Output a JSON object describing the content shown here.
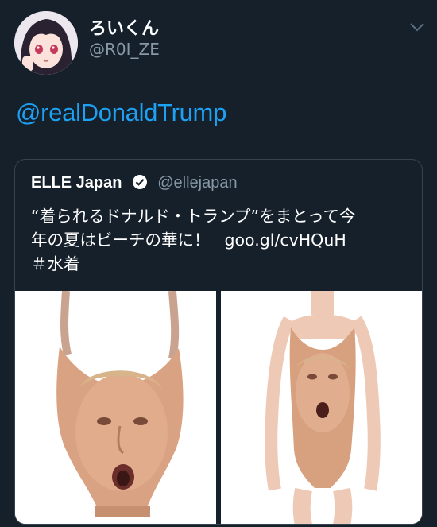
{
  "tweet": {
    "display_name": "ろいくん",
    "handle": "@R0I_ZE",
    "text": "@realDonaldTrump",
    "avatar_icon": "anime-girl-avatar",
    "menu_icon": "chevron-down-icon"
  },
  "quoted": {
    "display_name": "ELLE Japan",
    "handle": "@ellejapan",
    "text_line1": "“着られるドナルド・トランプ”をまとって今",
    "text_line2": "年の夏はビーチの華に！",
    "link": "goo.gl/cvHQuH",
    "hashtag": "＃水着"
  },
  "colors": {
    "background": "#15202b",
    "link": "#1da1f2",
    "secondary": "#8899a6",
    "border": "#38444d"
  }
}
